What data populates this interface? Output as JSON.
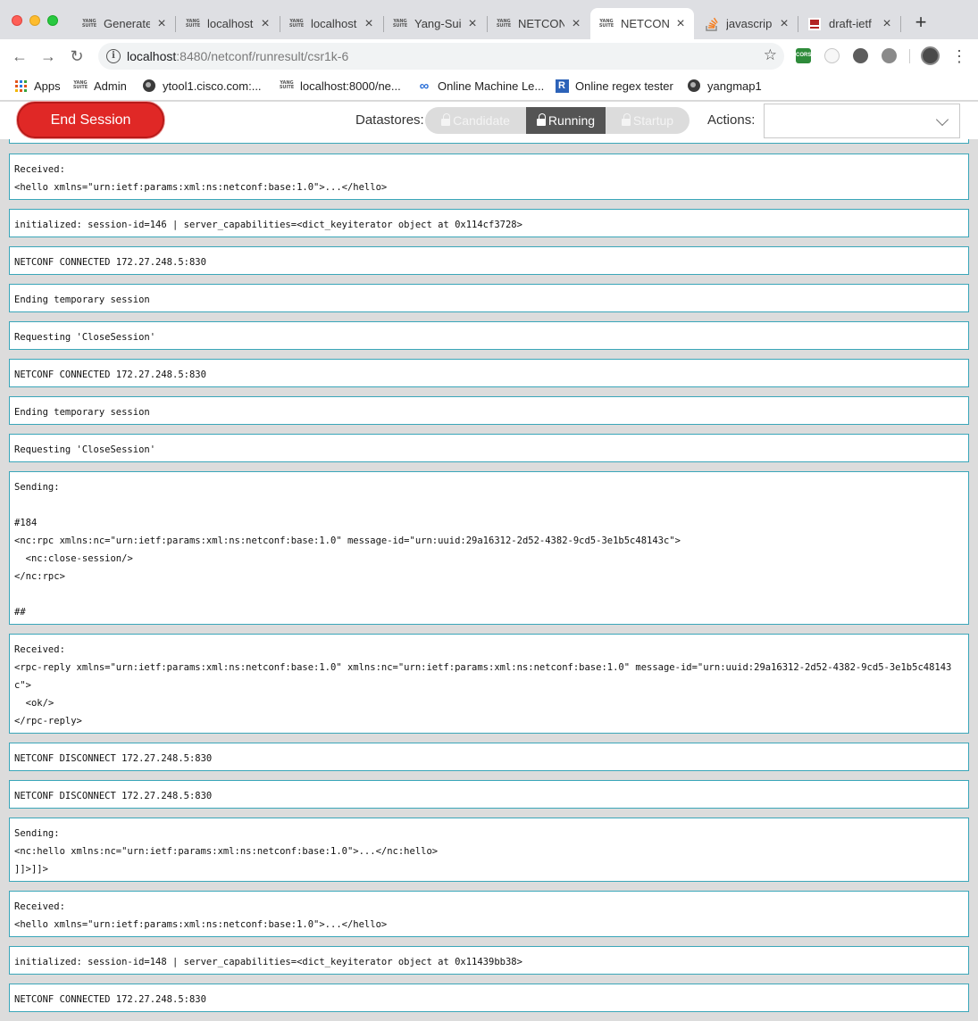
{
  "browser": {
    "tabs": [
      {
        "title": "Generate",
        "icon": "yang-suite-icon"
      },
      {
        "title": "localhost",
        "icon": "yang-suite-icon"
      },
      {
        "title": "localhost",
        "icon": "yang-suite-icon"
      },
      {
        "title": "Yang-Sui",
        "icon": "yang-suite-icon"
      },
      {
        "title": "NETCONI",
        "icon": "yang-suite-icon"
      },
      {
        "title": "NETCONI",
        "icon": "yang-suite-icon",
        "active": true
      },
      {
        "title": "javascrip",
        "icon": "stackoverflow-icon"
      },
      {
        "title": "draft-ietf",
        "icon": "ietf-html-icon"
      }
    ],
    "url_host": "localhost",
    "url_rest": ":8480/netconf/runresult/csr1k-6",
    "bookmarks": [
      {
        "label": "Apps"
      },
      {
        "label": "Admin"
      },
      {
        "label": "ytool1.cisco.com:..."
      },
      {
        "label": "localhost:8000/ne..."
      },
      {
        "label": "Online Machine Le..."
      },
      {
        "label": "Online regex tester"
      },
      {
        "label": "yangmap1"
      }
    ],
    "ext_cors": "CORS"
  },
  "header": {
    "end_session": "End Session",
    "datastores_label": "Datastores:",
    "datastores": [
      "Candidate",
      "Running",
      "Startup"
    ],
    "selected_datastore": "Running",
    "actions_label": "Actions:",
    "actions_value": ""
  },
  "log": [
    "Received:\n<hello xmlns=\"urn:ietf:params:xml:ns:netconf:base:1.0\">...</hello>",
    "initialized: session-id=146 | server_capabilities=<dict_keyiterator object at 0x114cf3728>",
    "NETCONF CONNECTED 172.27.248.5:830",
    "Ending temporary session",
    "Requesting 'CloseSession'",
    "NETCONF CONNECTED 172.27.248.5:830",
    "Ending temporary session",
    "Requesting 'CloseSession'",
    "Sending:\n\n#184\n<nc:rpc xmlns:nc=\"urn:ietf:params:xml:ns:netconf:base:1.0\" message-id=\"urn:uuid:29a16312-2d52-4382-9cd5-3e1b5c48143c\">\n  <nc:close-session/>\n</nc:rpc>\n\n##",
    "Received:\n<rpc-reply xmlns=\"urn:ietf:params:xml:ns:netconf:base:1.0\" xmlns:nc=\"urn:ietf:params:xml:ns:netconf:base:1.0\" message-id=\"urn:uuid:29a16312-2d52-4382-9cd5-3e1b5c48143c\">\n  <ok/>\n</rpc-reply>",
    "NETCONF DISCONNECT 172.27.248.5:830",
    "NETCONF DISCONNECT 172.27.248.5:830",
    "Sending:\n<nc:hello xmlns:nc=\"urn:ietf:params:xml:ns:netconf:base:1.0\">...</nc:hello>\n]]>]]>",
    "Received:\n<hello xmlns=\"urn:ietf:params:xml:ns:netconf:base:1.0\">...</hello>",
    "initialized: session-id=148 | server_capabilities=<dict_keyiterator object at 0x11439bb38>",
    "NETCONF CONNECTED 172.27.248.5:830"
  ]
}
